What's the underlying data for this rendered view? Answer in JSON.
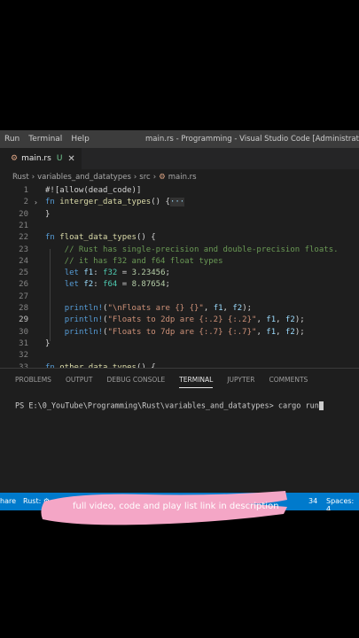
{
  "titlebar": {
    "menu": [
      "Run",
      "Terminal",
      "Help"
    ],
    "title": "main.rs - Programming - Visual Studio Code [Administrator]"
  },
  "tab": {
    "label": "main.rs",
    "modified": "U",
    "close": "✕",
    "icon": "rust-file-icon"
  },
  "breadcrumb": [
    "Rust",
    "variables_and_datatypes",
    "src",
    "main.rs"
  ],
  "editor": {
    "lines": [
      {
        "n": "1",
        "code": "#![allow(dead_code)]"
      },
      {
        "n": "2",
        "code": "fn interger_data_types() {···"
      },
      {
        "n": "20",
        "code": "}"
      },
      {
        "n": "21",
        "code": ""
      },
      {
        "n": "22",
        "code": "fn float_data_types() {"
      },
      {
        "n": "23",
        "code": "    // Rust has single-precision and double-precision floats."
      },
      {
        "n": "24",
        "code": "    // it has f32 and f64 float types"
      },
      {
        "n": "25",
        "code": "    let f1: f32 = 3.23456;"
      },
      {
        "n": "26",
        "code": "    let f2: f64 = 8.87654;"
      },
      {
        "n": "27",
        "code": ""
      },
      {
        "n": "28",
        "code": "    println!(\"\\nFloats are {} {}\", f1, f2);"
      },
      {
        "n": "29",
        "code": "    println!(\"Floats to 2dp are {:.2} {:.2}\", f1, f2);"
      },
      {
        "n": "30",
        "code": "    println!(\"Floats to 7dp are {:.7} {:.7}\", f1, f2);"
      },
      {
        "n": "31",
        "code": "}"
      },
      {
        "n": "32",
        "code": ""
      },
      {
        "n": "33",
        "code": "fn other_data_types() {"
      }
    ]
  },
  "panel": {
    "tabs": [
      "PROBLEMS",
      "OUTPUT",
      "DEBUG CONSOLE",
      "TERMINAL",
      "JUPYTER",
      "COMMENTS"
    ],
    "active_tab": "TERMINAL",
    "prompt": "PS E:\\0_YouTube\\Programming\\Rust\\variables_and_datatypes>",
    "command": " cargo run"
  },
  "statusbar": {
    "left1": "hare",
    "left2": "Rust:",
    "right1": "34",
    "right2": "Spaces: 4"
  },
  "banner": {
    "text": "full video, code and play list link in description"
  },
  "colors": {
    "status": "#007acc",
    "banner": "#f4a6c6",
    "editor_bg": "#1e1e1e"
  }
}
